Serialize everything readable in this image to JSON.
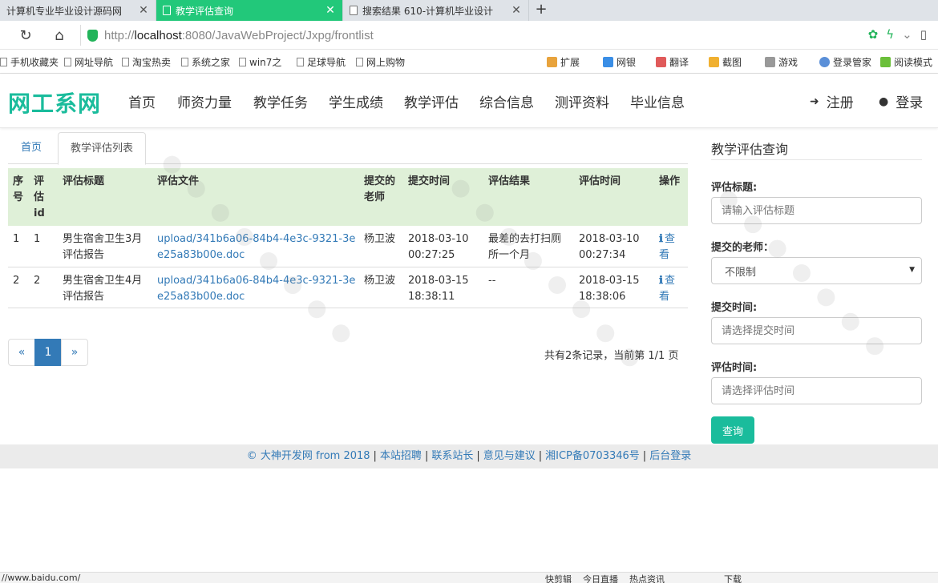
{
  "browser": {
    "tabs": [
      {
        "title": "计算机专业毕业设计源码网",
        "active": false
      },
      {
        "title": "教学评估查询",
        "active": true
      },
      {
        "title": "搜索结果 610-计算机毕业设计",
        "active": false
      }
    ],
    "new_tab_label": "+",
    "url_prefix": "http://",
    "url_host": "localhost",
    "url_rest": ":8080/JavaWebProject/Jxpg/frontlist",
    "bookmarks": [
      "手机收藏夹",
      "网址导航",
      "淘宝热卖",
      "系统之家",
      "win7之",
      "足球导航",
      "网上购物"
    ],
    "toolbar_items": [
      "扩展",
      "网银",
      "翻译",
      "截图",
      "游戏",
      "登录管家",
      "阅读模式"
    ],
    "status_url": "//www.baidu.com/",
    "status_items": [
      "快剪辑",
      "今日直播",
      "热点资讯",
      "下载"
    ]
  },
  "site": {
    "brand": "网工系网",
    "menu": [
      "首页",
      "师资力量",
      "教学任务",
      "学生成绩",
      "教学评估",
      "综合信息",
      "测评资料",
      "毕业信息"
    ],
    "register": "注册",
    "login": "登录"
  },
  "breadcrumb": {
    "home": "首页",
    "current": "教学评估列表"
  },
  "table": {
    "headers": [
      "序号",
      "评估id",
      "评估标题",
      "评估文件",
      "提交的老师",
      "提交时间",
      "评估结果",
      "评估时间",
      "操作"
    ],
    "rows": [
      {
        "no": "1",
        "id": "1",
        "title": "男生宿舍卫生3月评估报告",
        "file": "upload/341b6a06-84b4-4e3c-9321-3ee25a83b00e.doc",
        "teacher": "杨卫波",
        "submit_time": "2018-03-10 00:27:25",
        "result": "最差的去打扫厕所一个月",
        "eval_time": "2018-03-10 00:27:34",
        "action": "查看"
      },
      {
        "no": "2",
        "id": "2",
        "title": "男生宿舍卫生4月评估报告",
        "file": "upload/341b6a06-84b4-4e3c-9321-3ee25a83b00e.doc",
        "teacher": "杨卫波",
        "submit_time": "2018-03-15 18:38:11",
        "result": "--",
        "eval_time": "2018-03-15 18:38:06",
        "action": "查看"
      }
    ]
  },
  "pagination": {
    "prev": "«",
    "current": "1",
    "next": "»",
    "info": "共有2条记录，当前第 1/1 页"
  },
  "search": {
    "title": "教学评估查询",
    "fields": {
      "title_label": "评估标题:",
      "title_placeholder": "请输入评估标题",
      "teacher_label": "提交的老师：",
      "teacher_value": "不限制",
      "submit_label": "提交时间:",
      "submit_placeholder": "请选择提交时间",
      "eval_label": "评估时间:",
      "eval_placeholder": "请选择评估时间"
    },
    "button": "查询"
  },
  "footer": {
    "links": [
      "© 大神开发网 from 2018",
      "本站招聘",
      "联系站长",
      "意见与建议",
      "湘ICP备0703346号",
      "后台登录"
    ]
  },
  "colors": {
    "brand": "#1abc9c",
    "link": "#337ab7",
    "table_header": "#dff0d8",
    "active_tab": "#22c87a"
  }
}
